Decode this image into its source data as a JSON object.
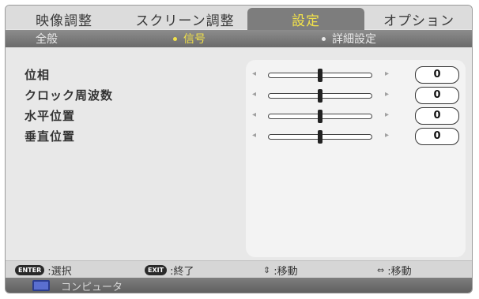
{
  "tabs": [
    {
      "label": "映像調整"
    },
    {
      "label": "スクリーン調整"
    },
    {
      "label": "設定",
      "active": true
    },
    {
      "label": "オプション"
    }
  ],
  "subtabs": [
    {
      "label": "全般"
    },
    {
      "label": "信号",
      "active": true
    },
    {
      "label": "詳細設定"
    }
  ],
  "settings": [
    {
      "label": "位相",
      "value": "0",
      "level": 0.5
    },
    {
      "label": "クロック周波数",
      "value": "0",
      "level": 0.5
    },
    {
      "label": "水平位置",
      "value": "0",
      "level": 0.5
    },
    {
      "label": "垂直位置",
      "value": "0",
      "level": 0.5
    }
  ],
  "footer": {
    "enter_key": "ENTER",
    "enter_label": ":選択",
    "exit_key": "EXIT",
    "exit_label": ":終了",
    "updown_glyph": "⇕",
    "updown_label": ":移動",
    "leftright_glyph": "⇔",
    "leftright_label": ":移動"
  },
  "source": {
    "label": "コンピュータ",
    "icon": "computer-icon"
  },
  "colors": {
    "active_tab_text": "#f2e24a",
    "active_tab_bg": "#7d7d7d"
  }
}
